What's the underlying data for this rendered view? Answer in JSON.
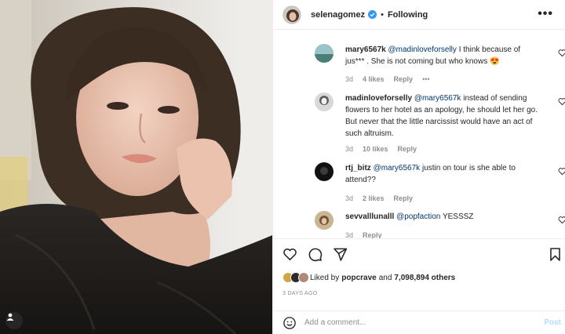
{
  "header": {
    "username": "selenagomez",
    "separator": "•",
    "follow_status": "Following",
    "more_label": "•••"
  },
  "comments": [
    {
      "username": "mary6567k",
      "mention": "@madinloveforselly",
      "text": " I think because of jus*** . She is not coming but who knows 😍",
      "time": "3d",
      "likes": "4 likes",
      "reply": "Reply",
      "more": "•••"
    },
    {
      "username": "madinloveforselly",
      "mention": "@mary6567k",
      "text": " instead of sending flowers to her hotel as an apology, he should let her go. But never that the little narcissist would have an act of such altruism.",
      "time": "3d",
      "likes": "10 likes",
      "reply": "Reply"
    },
    {
      "username": "rtj_bitz",
      "mention": "@mary6567k",
      "text": " justin on tour is she able to attend??",
      "time": "3d",
      "likes": "2 likes",
      "reply": "Reply"
    },
    {
      "username": "sevvalllunalll",
      "mention": "@popfaction",
      "text": " YESSSZ",
      "time": "3d",
      "likes": "",
      "reply": "Reply"
    }
  ],
  "likes": {
    "prefix": "Liked by",
    "user": "popcrave",
    "and": "and",
    "count": "7,098,894 others"
  },
  "timestamp": "3 DAYS AGO",
  "add_comment": {
    "placeholder": "Add a comment...",
    "post_label": "Post"
  },
  "colors": {
    "link": "#00376b",
    "muted": "#8e8e8e",
    "verified": "#3897f0",
    "post_disabled": "#b2dffc"
  }
}
